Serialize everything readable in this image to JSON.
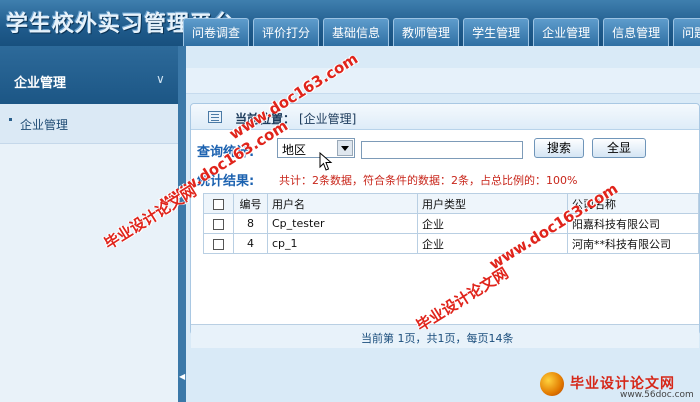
{
  "app": {
    "title": "学生校外实习管理平台"
  },
  "nav": {
    "tabs": [
      "问卷调查",
      "评价打分",
      "基础信息",
      "教师管理",
      "学生管理",
      "企业管理",
      "信息管理",
      "问题答"
    ]
  },
  "sidebar": {
    "title": "企业管理",
    "items": [
      {
        "label": "企业管理"
      }
    ]
  },
  "breadcrumb": {
    "label": "当前位置：",
    "value": "[企业管理]"
  },
  "query": {
    "label": "查询统计:",
    "field_value": "地区",
    "text_value": "",
    "search_button": "搜索",
    "show_all_button": "全显"
  },
  "result": {
    "label": "统计结果:",
    "summary": "共计：2条数据，符合条件的数据：2条，占总比例的：100%"
  },
  "table": {
    "columns": [
      "编号",
      "用户名",
      "用户类型",
      "公司名称"
    ],
    "rows": [
      {
        "id": "8",
        "username": "Cp_tester",
        "type": "企业",
        "company": "阳嘉科技有限公司"
      },
      {
        "id": "4",
        "username": "cp_1",
        "type": "企业",
        "company": "河南**科技有限公司"
      }
    ]
  },
  "pager": {
    "text": "当前第 1页，共1页，每页14条"
  },
  "watermark": {
    "site": "www.doc163.com",
    "name": "毕业设计论文网",
    "brand": "毕业设计论文网",
    "brand_url": "www.56doc.com"
  },
  "icons": {
    "chevron": "chevron-down-icon",
    "breadcrumb": "list-icon",
    "dropdown": "caret-down-icon",
    "cursor": "mouse-pointer-icon"
  },
  "colors": {
    "accent": "#1f5b8c",
    "label_blue": "#1c62b0",
    "result_red": "#c8261b"
  }
}
